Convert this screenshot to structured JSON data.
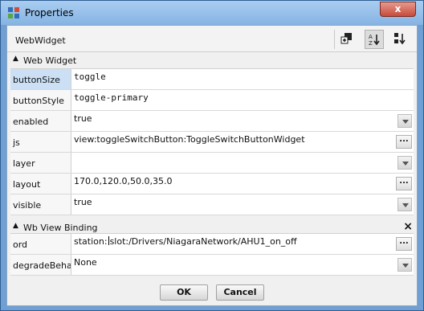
{
  "window": {
    "title": "Properties",
    "close_label": "x"
  },
  "header": {
    "title": "WebWidget"
  },
  "sections": {
    "web_widget": {
      "label": "Web Widget"
    },
    "wb_view_binding": {
      "label": "Wb View Binding",
      "close_label": "×"
    }
  },
  "web_widget_rows": [
    {
      "name": "buttonSize",
      "value": "toggle"
    },
    {
      "name": "buttonStyle",
      "value": "toggle-primary"
    },
    {
      "name": "enabled",
      "value": "true"
    },
    {
      "name": "js",
      "value": "view:toggleSwitchButton:ToggleSwitchButtonWidget"
    },
    {
      "name": "layer",
      "value": ""
    },
    {
      "name": "layout",
      "value": "170.0,120.0,50.0,35.0"
    },
    {
      "name": "visible",
      "value": "true"
    }
  ],
  "binding_rows": [
    {
      "name": "ord",
      "value_before_cursor": "station:",
      "value_after_cursor": "slot:/Drivers/NiagaraNetwork/AHU1_on_off"
    },
    {
      "name": "degradeBehav",
      "value": "None"
    }
  ],
  "ellipsis_label": "...",
  "buttons": {
    "ok": "OK",
    "cancel": "Cancel"
  },
  "colors": {
    "title_bar": "#a9cdf0",
    "close": "#c94b3b",
    "selected_row": "#cbe0f5"
  }
}
